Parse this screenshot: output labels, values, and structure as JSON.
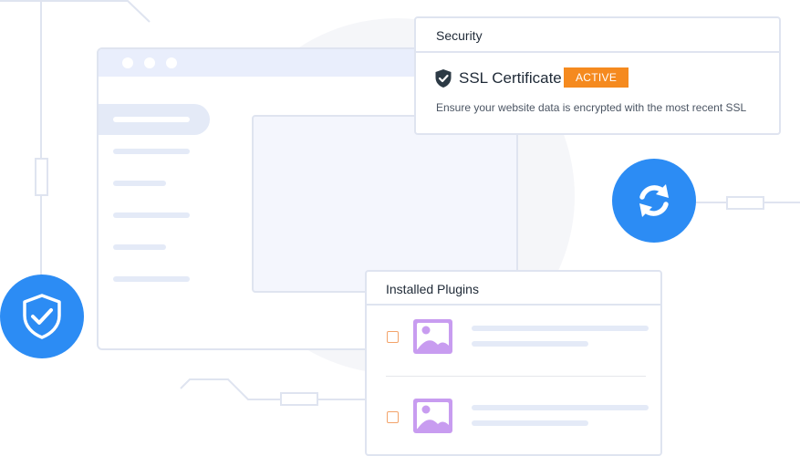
{
  "security_card": {
    "title": "Security",
    "item_title": "SSL Certificate",
    "status_badge": "ACTIVE",
    "description": "Ensure your website data is encrypted with the most recent SSL"
  },
  "plugins_card": {
    "title": "Installed Plugins",
    "plugins": [
      {
        "icon": "image-icon"
      },
      {
        "icon": "image-icon"
      }
    ]
  },
  "icons": {
    "shield": "shield-check-icon",
    "sync": "sync-icon",
    "ssl": "shield-check-icon"
  },
  "colors": {
    "accent_blue": "#2c8cf4",
    "badge_orange": "#f58a1f",
    "plugin_purple": "#c89cf0",
    "line": "#dfe4f0"
  }
}
